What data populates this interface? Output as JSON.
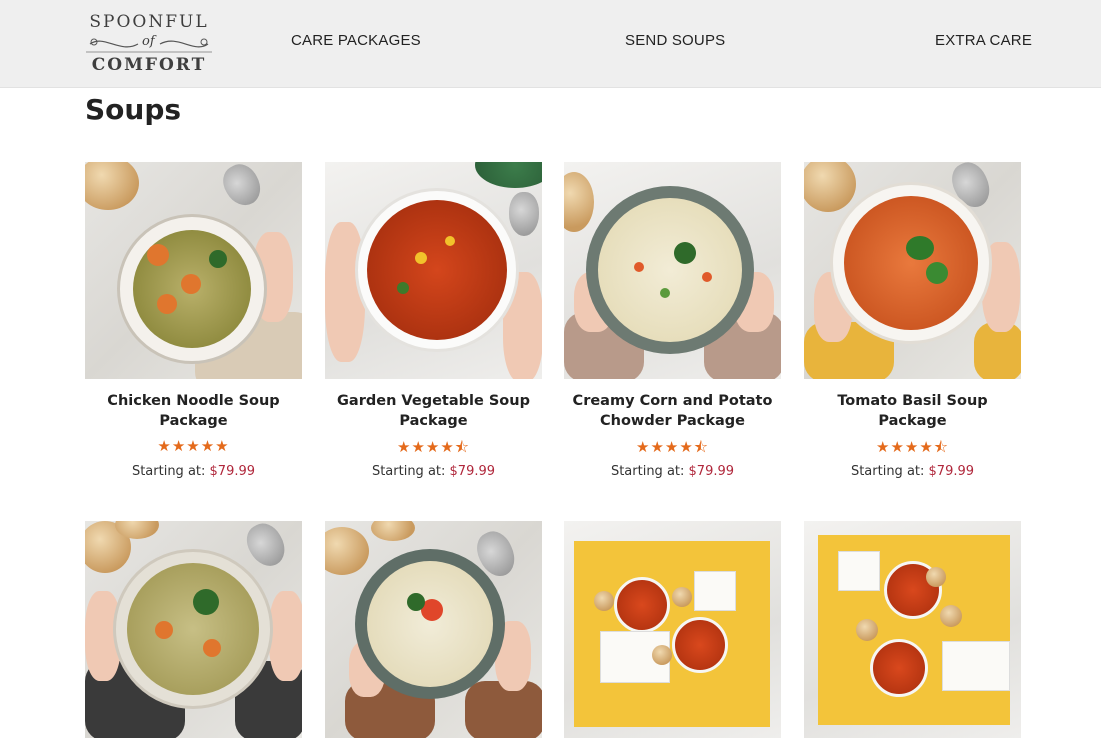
{
  "brand": {
    "logo_top": "SPOONFUL",
    "logo_of": "of",
    "logo_bottom": "COMFORT"
  },
  "nav": {
    "items": [
      {
        "label": "CARE PACKAGES"
      },
      {
        "label": "SEND SOUPS"
      },
      {
        "label": "EXTRA CARE"
      }
    ]
  },
  "page": {
    "title": "Soups"
  },
  "products": [
    {
      "name": "Chicken Noodle Soup Package",
      "rating": 5,
      "stars": "★★★★★",
      "price_label": "Starting at:",
      "price": "$79.99",
      "image": "chicken-noodle-soup-photo"
    },
    {
      "name": "Garden Vegetable Soup Package",
      "rating": 4.5,
      "stars": "★★★★⯪",
      "price_label": "Starting at:",
      "price": "$79.99",
      "image": "garden-vegetable-soup-photo"
    },
    {
      "name": "Creamy Corn and Potato Chowder Package",
      "rating": 4.5,
      "stars": "★★★★⯪",
      "price_label": "Starting at:",
      "price": "$79.99",
      "image": "corn-potato-chowder-photo"
    },
    {
      "name": "Tomato Basil Soup Package",
      "rating": 4.5,
      "stars": "★★★★⯪",
      "price_label": "Starting at:",
      "price": "$79.99",
      "image": "tomato-basil-soup-photo"
    },
    {
      "image": "chicken-dumpling-soup-photo"
    },
    {
      "image": "creamy-chowder-soup-photo"
    },
    {
      "image": "soup-care-package-box-photo"
    },
    {
      "image": "soup-sampler-box-photo"
    }
  ],
  "colors": {
    "header_bg": "#efefef",
    "star": "#e46a1b",
    "price": "#b0273b"
  }
}
